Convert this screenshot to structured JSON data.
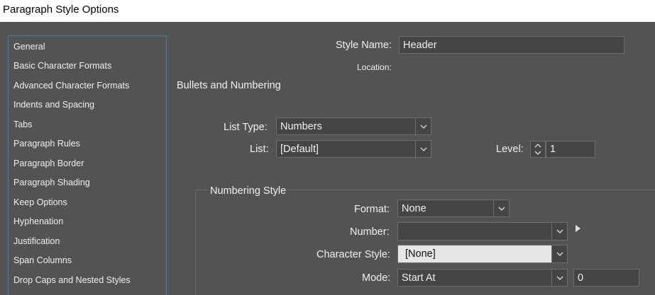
{
  "window": {
    "title": "Paragraph Style Options"
  },
  "sidebar": {
    "items": [
      {
        "label": "General"
      },
      {
        "label": "Basic Character Formats"
      },
      {
        "label": "Advanced Character Formats"
      },
      {
        "label": "Indents and Spacing"
      },
      {
        "label": "Tabs"
      },
      {
        "label": "Paragraph Rules"
      },
      {
        "label": "Paragraph Border"
      },
      {
        "label": "Paragraph Shading"
      },
      {
        "label": "Keep Options"
      },
      {
        "label": "Hyphenation"
      },
      {
        "label": "Justification"
      },
      {
        "label": "Span Columns"
      },
      {
        "label": "Drop Caps and Nested Styles"
      }
    ]
  },
  "header": {
    "style_name_label": "Style Name:",
    "style_name_value": "Header",
    "location_label": "Location:"
  },
  "section": {
    "title": "Bullets and Numbering"
  },
  "list_type": {
    "label": "List Type:",
    "value": "Numbers"
  },
  "list": {
    "label": "List:",
    "value": "[Default]"
  },
  "level": {
    "label": "Level:",
    "value": "1"
  },
  "numbering_style": {
    "title": "Numbering Style",
    "format": {
      "label": "Format:",
      "value": "None"
    },
    "number": {
      "label": "Number:",
      "value": ""
    },
    "character_style": {
      "label": "Character Style:",
      "value": "[None]"
    },
    "mode": {
      "label": "Mode:",
      "value": "Start At",
      "start_value": "0"
    }
  },
  "colors": {
    "background": "#535353",
    "field": "#454545",
    "focus_border": "#3e7fb1"
  }
}
